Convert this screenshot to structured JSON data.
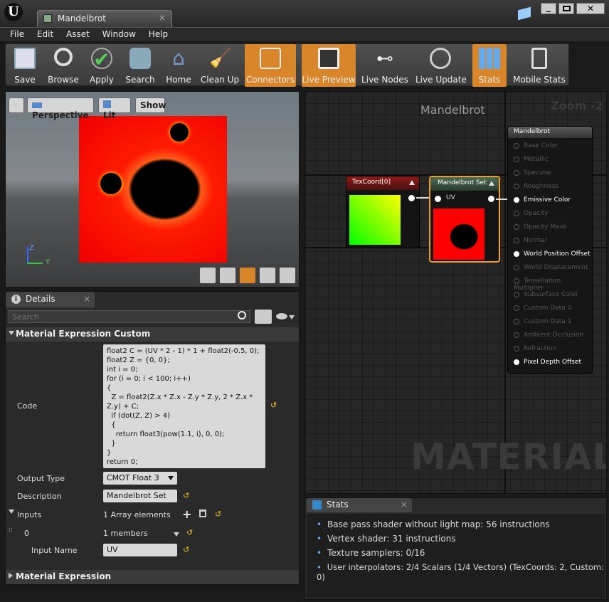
{
  "window": {
    "tab_title": "Mandelbrot",
    "buttons": [
      "minimize",
      "maximize",
      "close"
    ]
  },
  "menu": [
    "File",
    "Edit",
    "Asset",
    "Window",
    "Help"
  ],
  "toolbar": [
    {
      "label": "Save",
      "icon": "save-icon",
      "active": false
    },
    {
      "label": "Browse",
      "icon": "browse-icon",
      "active": false
    },
    {
      "label": "Apply",
      "icon": "apply-icon",
      "active": false
    },
    {
      "label": "Search",
      "icon": "search-icon",
      "active": false
    },
    {
      "label": "Home",
      "icon": "home-icon",
      "active": false
    },
    {
      "label": "Clean Up",
      "icon": "clean-up-icon",
      "active": false
    },
    {
      "label": "Connectors",
      "icon": "connectors-icon",
      "active": true
    },
    {
      "label": "Live Preview",
      "icon": "live-preview-icon",
      "active": true
    },
    {
      "label": "Live Nodes",
      "icon": "live-nodes-icon",
      "active": false
    },
    {
      "label": "Live Update",
      "icon": "live-update-icon",
      "active": false
    },
    {
      "label": "Stats",
      "icon": "stats-icon",
      "active": true
    },
    {
      "label": "Mobile Stats",
      "icon": "mobile-stats-icon",
      "active": false
    }
  ],
  "viewport": {
    "perspective": "Perspective",
    "lit": "Lit",
    "show": "Show",
    "axis_z": "Z",
    "axis_y": "Y"
  },
  "details": {
    "tab": "Details",
    "search_placeholder": "Search",
    "section": "Material Expression Custom",
    "code_label": "Code",
    "code": "float2 C = (UV * 2 - 1) * 1 + float2(-0.5, 0);\nfloat2 Z = {0, 0};\nint i = 0;\nfor (i = 0; i < 100; i++)\n{\n  Z = float2(Z.x * Z.x - Z.y * Z.y, 2 * Z.x *\nZ.y) + C;\n  if (dot(Z, Z) > 4)\n  {\n    return float3(pow(1.1, i), 0, 0);\n  }\n}\nreturn 0;",
    "output_type_label": "Output Type",
    "output_type": "CMOT Float 3",
    "description_label": "Description",
    "description": "Mandelbrot Set",
    "inputs_label": "Inputs",
    "inputs_value": "1 Array elements",
    "index_label": "0",
    "index_value": "1 members",
    "input_name_label": "Input Name",
    "input_name": "UV",
    "section2": "Material Expression"
  },
  "graph": {
    "title": "Mandelbrot",
    "zoom": "Zoom -2",
    "watermark": "MATERIAL",
    "texcoord_title": "TexCoord[0]",
    "mset_title": "Mandelbrot Set",
    "mset_pin": "UV",
    "result_title": "Mandelbrot",
    "result_pins": [
      {
        "label": "Base Color",
        "active": false
      },
      {
        "label": "Metallic",
        "active": false
      },
      {
        "label": "Specular",
        "active": false
      },
      {
        "label": "Roughness",
        "active": false
      },
      {
        "label": "Emissive Color",
        "active": true
      },
      {
        "label": "Opacity",
        "active": false
      },
      {
        "label": "Opacity Mask",
        "active": false
      },
      {
        "label": "Normal",
        "active": false
      },
      {
        "label": "World Position Offset",
        "active": true
      },
      {
        "label": "World Displacement",
        "active": false
      },
      {
        "label": "Tessellation Multiplier",
        "active": false
      },
      {
        "label": "Subsurface Color",
        "active": false
      },
      {
        "label": "Custom Data 0",
        "active": false
      },
      {
        "label": "Custom Data 1",
        "active": false
      },
      {
        "label": "Ambient Occlusion",
        "active": false
      },
      {
        "label": "Refraction",
        "active": false
      },
      {
        "label": "Pixel Depth Offset",
        "active": true
      }
    ]
  },
  "stats": {
    "tab": "Stats",
    "lines": [
      "Base pass shader without light map: 56 instructions",
      "Vertex shader: 31 instructions",
      "Texture samplers: 0/16",
      "User interpolators: 2/4 Scalars (1/4 Vectors) (TexCoords: 2, Custom: 0)"
    ]
  },
  "colors": {
    "accent": "#d9862a",
    "selected_node": "#f0a020",
    "mandel_red": "#ff1a00"
  }
}
